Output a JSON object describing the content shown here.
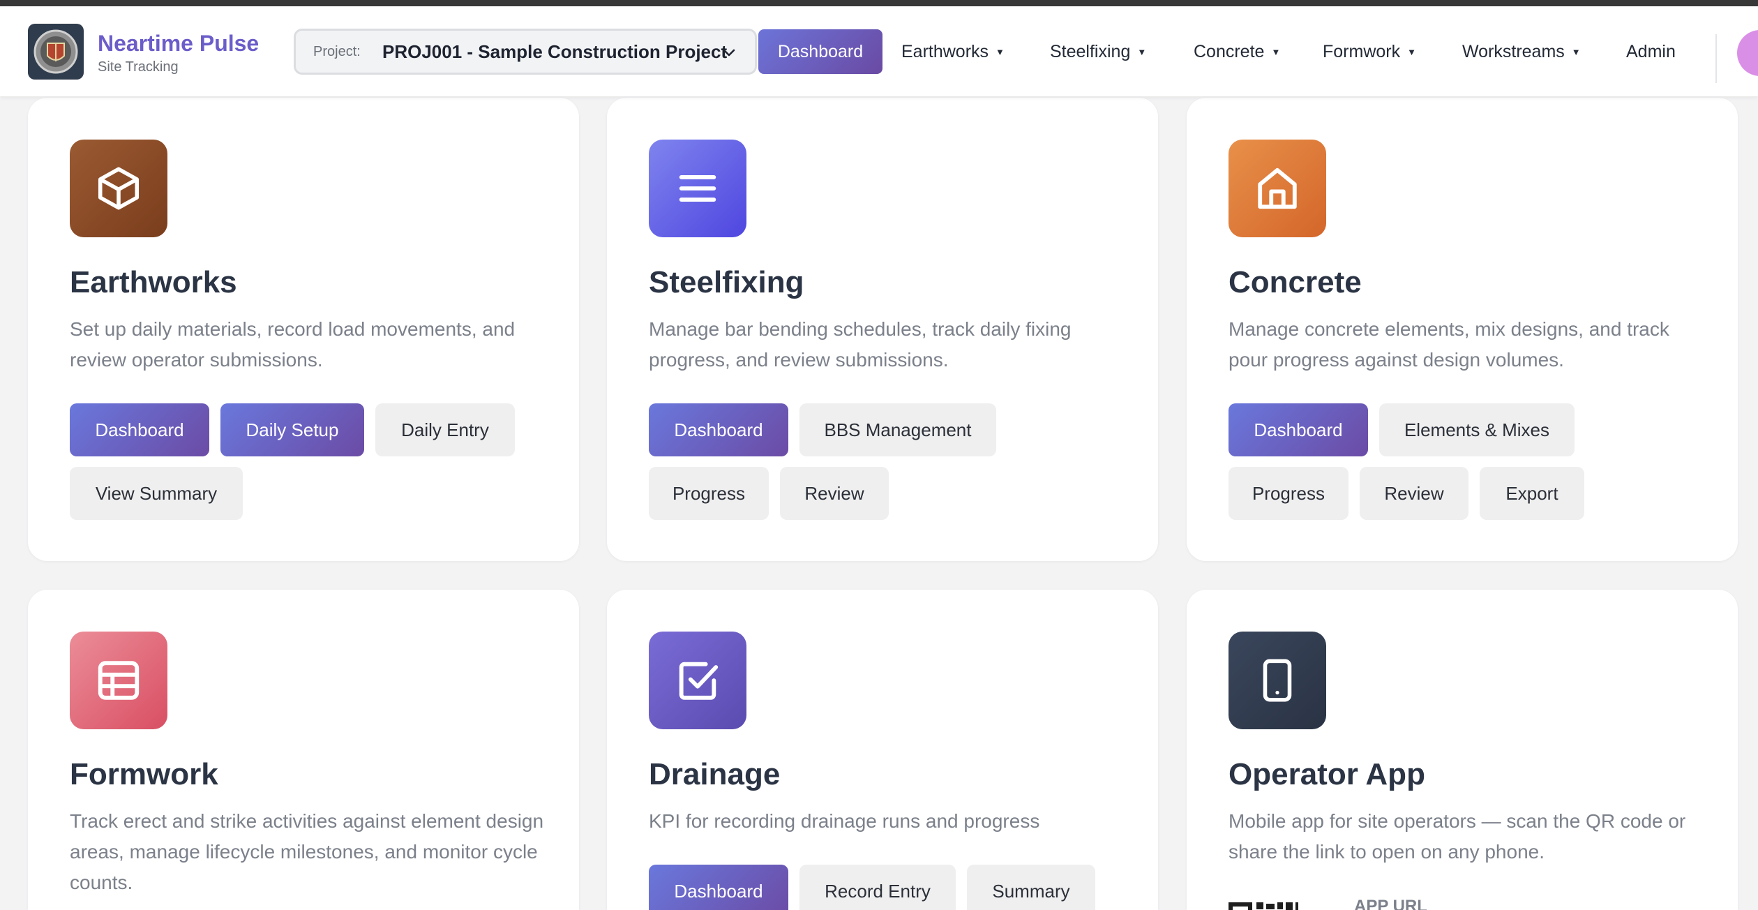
{
  "brand": {
    "name": "Neartime Pulse",
    "subtitle": "Site Tracking"
  },
  "project": {
    "label": "Project:",
    "value": "PROJ001 - Sample Construction Project"
  },
  "nav": {
    "dashboard": "Dashboard",
    "earthworks": "Earthworks",
    "steelfixing": "Steelfixing",
    "concrete": "Concrete",
    "formwork": "Formwork",
    "workstreams": "Workstreams",
    "admin": "Admin",
    "caret": "▼"
  },
  "cards": {
    "earthworks": {
      "title": "Earthworks",
      "description": "Set up daily materials, record load movements, and review operator submissions.",
      "icon": "box-icon",
      "color": "#8a4a24",
      "buttons": [
        "Dashboard",
        "Daily Setup",
        "Daily Entry",
        "View Summary"
      ]
    },
    "steelfixing": {
      "title": "Steelfixing",
      "description": "Manage bar bending schedules, track daily fixing progress, and review submissions.",
      "icon": "menu-lines-icon",
      "color": "#5f5ee6",
      "buttons": [
        "Dashboard",
        "BBS Management",
        "Progress",
        "Review"
      ]
    },
    "concrete": {
      "title": "Concrete",
      "description": "Manage concrete elements, mix designs, and track pour progress against design volumes.",
      "icon": "home-icon",
      "color": "#e07a35",
      "buttons": [
        "Dashboard",
        "Elements & Mixes",
        "Progress",
        "Review",
        "Export"
      ]
    },
    "formwork": {
      "title": "Formwork",
      "description": "Track erect and strike activities against element design areas, manage lifecycle milestones, and monitor cycle counts.",
      "icon": "table-icon",
      "color": "#e06277"
    },
    "drainage": {
      "title": "Drainage",
      "description": "KPI for recording drainage runs and progress",
      "icon": "checkbox-icon",
      "color": "#6a5cc4",
      "buttons": [
        "Dashboard",
        "Record Entry",
        "Summary"
      ]
    },
    "operator": {
      "title": "Operator App",
      "description": "Mobile app for site operators — scan the QR code or share the link to open on any phone.",
      "icon": "phone-icon",
      "color": "#323d51",
      "url_label": "APP URL"
    }
  }
}
